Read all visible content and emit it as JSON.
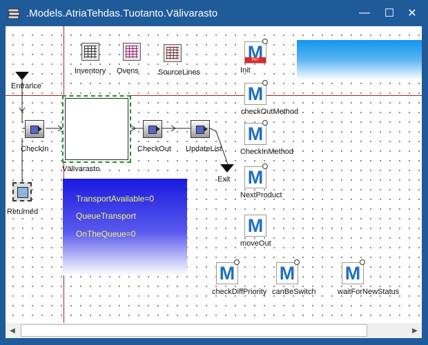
{
  "window": {
    "title": ".Models.AtriaTehdas.Tuotanto.Välivarasto",
    "minimize_glyph": "—",
    "maximize_glyph": "☐",
    "close_glyph": "✕"
  },
  "tables": [
    {
      "label": "Inventory",
      "icon": "table-icon"
    },
    {
      "label": "Ovens",
      "icon": "table-icon"
    },
    {
      "label": "SourceLines",
      "icon": "table-icon"
    }
  ],
  "stations": {
    "entrance": "Entrance",
    "checkin": "CheckIn",
    "buffer": "Välivarasto",
    "checkout": "CheckOut",
    "updatelist": "UpdateList",
    "exit": "Exit",
    "returned": "Returned"
  },
  "methods": [
    {
      "label": "Init",
      "icon": "method-icon"
    },
    {
      "label": "checkOutMethod",
      "icon": "method-icon"
    },
    {
      "label": "CheckInMethod",
      "icon": "method-icon"
    },
    {
      "label": "NextProduct",
      "icon": "method-icon"
    },
    {
      "label": "moveOut",
      "icon": "method-icon"
    },
    {
      "label": "checkDiffPriority",
      "icon": "method-icon"
    },
    {
      "label": "canBeSwitch",
      "icon": "method-icon"
    },
    {
      "label": "waitForNewStatus",
      "icon": "method-icon"
    }
  ],
  "init_badge": "INIT",
  "info": {
    "transport_available": "TransportAvailable=0",
    "queue_transport": "QueueTransport",
    "on_the_queue": "OnTheQueue=0"
  },
  "scroll": {
    "left_arrow": "◀",
    "right_arrow": "▶"
  },
  "colors": {
    "titlebar": "#1f5b99",
    "guide_line": "#b41c1c",
    "method_letter": "#1e6fc0",
    "info_text": "#f5f567",
    "init_badge": "#e02828"
  }
}
